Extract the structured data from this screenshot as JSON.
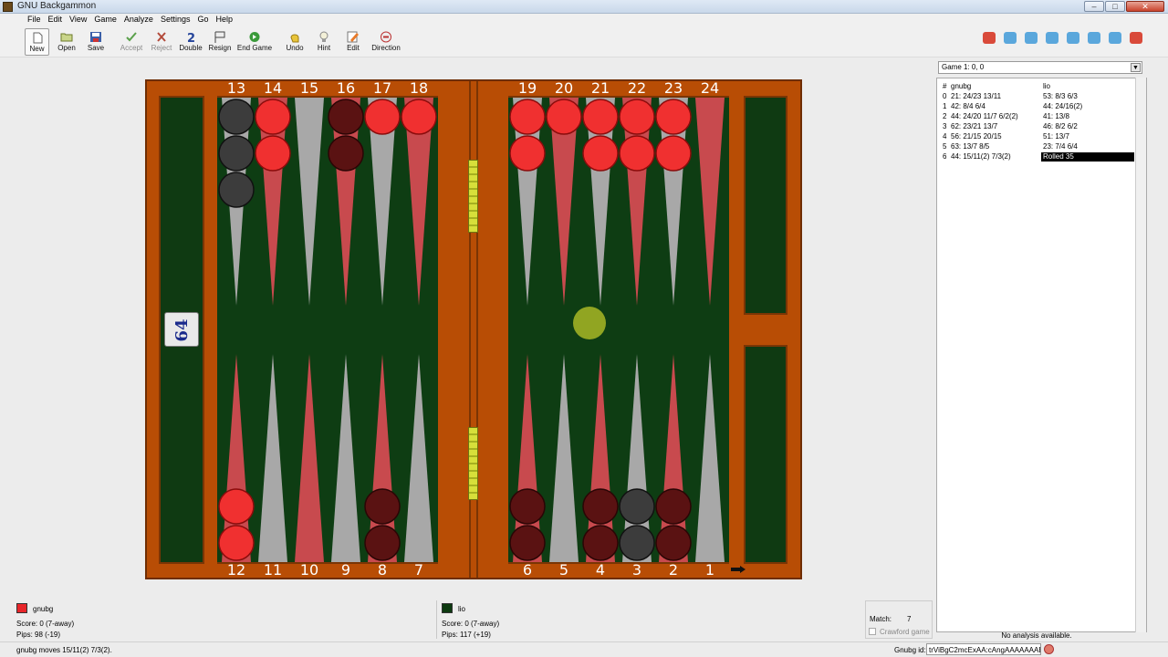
{
  "window": {
    "title": "GNU Backgammon",
    "minimize": "–",
    "maximize": "□",
    "close": "✕"
  },
  "menu": [
    "File",
    "Edit",
    "View",
    "Game",
    "Analyze",
    "Settings",
    "Go",
    "Help"
  ],
  "toolbar": [
    {
      "label": "New",
      "icon": "new-document-icon",
      "state": "pressed"
    },
    {
      "label": "Open",
      "icon": "open-folder-icon",
      "state": "normal"
    },
    {
      "label": "Save",
      "icon": "save-disk-icon",
      "state": "normal"
    },
    {
      "label": "Accept",
      "icon": "check-icon",
      "state": "disabled"
    },
    {
      "label": "Reject",
      "icon": "cross-icon",
      "state": "disabled"
    },
    {
      "label": "Double",
      "icon": "double-2-icon",
      "state": "normal"
    },
    {
      "label": "Resign",
      "icon": "flag-icon",
      "state": "normal"
    },
    {
      "label": "End Game",
      "icon": "end-game-icon",
      "state": "normal"
    },
    {
      "label": "Undo",
      "icon": "undo-hand-icon",
      "state": "normal"
    },
    {
      "label": "Hint",
      "icon": "lightbulb-icon",
      "state": "normal"
    },
    {
      "label": "Edit",
      "icon": "pencil-icon",
      "state": "normal"
    },
    {
      "label": "Direction",
      "icon": "direction-icon",
      "state": "normal"
    }
  ],
  "nav_icons": [
    "prev-game-icon",
    "prev-roll-icon",
    "prev-marked-icon",
    "prev-cmark-icon",
    "next-cmark-icon",
    "next-marked-icon",
    "next-roll-icon",
    "next-game-icon",
    "stop-icon"
  ],
  "colors": {
    "player1": "#e8262a",
    "player2": "#3a3a3a",
    "board_frame": "#b84d05",
    "felt": "#0e3d13",
    "point_red": "#c84a4e",
    "point_grey": "#a8a8a8"
  },
  "board": {
    "top_numbers": [
      "13",
      "14",
      "15",
      "16",
      "17",
      "18",
      "19",
      "20",
      "21",
      "22",
      "23",
      "24"
    ],
    "bottom_numbers": [
      "12",
      "11",
      "10",
      "9",
      "8",
      "7",
      "6",
      "5",
      "4",
      "3",
      "2",
      "1"
    ],
    "cube": "64",
    "checkers": {
      "top": [
        {
          "point": "13",
          "color": "dark",
          "count": 3
        },
        {
          "point": "14",
          "color": "red",
          "count": 2
        },
        {
          "point": "15",
          "color": "",
          "count": 0
        },
        {
          "point": "16",
          "color": "maroon",
          "count": 2
        },
        {
          "point": "17",
          "color": "red",
          "count": 1
        },
        {
          "point": "18",
          "color": "red",
          "count": 1
        },
        {
          "point": "19",
          "color": "red",
          "count": 2
        },
        {
          "point": "20",
          "color": "red",
          "count": 1
        },
        {
          "point": "21",
          "color": "red",
          "count": 2
        },
        {
          "point": "22",
          "color": "red",
          "count": 2
        },
        {
          "point": "23",
          "color": "red",
          "count": 2
        },
        {
          "point": "24",
          "color": "",
          "count": 0
        }
      ],
      "bottom": [
        {
          "point": "12",
          "color": "red",
          "count": 2
        },
        {
          "point": "11",
          "color": "",
          "count": 0
        },
        {
          "point": "10",
          "color": "",
          "count": 0
        },
        {
          "point": "9",
          "color": "",
          "count": 0
        },
        {
          "point": "8",
          "color": "maroon",
          "count": 2
        },
        {
          "point": "7",
          "color": "",
          "count": 0
        },
        {
          "point": "6",
          "color": "maroon",
          "count": 2
        },
        {
          "point": "5",
          "color": "",
          "count": 0
        },
        {
          "point": "4",
          "color": "maroon",
          "count": 2
        },
        {
          "point": "3",
          "color": "dark",
          "count": 2
        },
        {
          "point": "2",
          "color": "maroon",
          "count": 2
        },
        {
          "point": "1",
          "color": "",
          "count": 0
        }
      ]
    }
  },
  "game_select": "Game 1: 0, 0",
  "movelist": {
    "headers": [
      "#",
      "gnubg",
      "lio"
    ],
    "rows": [
      {
        "n": "0",
        "gnubg": "21: 24/23 13/11",
        "lio": "53: 8/3 6/3",
        "selected": false
      },
      {
        "n": "1",
        "gnubg": "42: 8/4 6/4",
        "lio": "44: 24/16(2)",
        "selected": false
      },
      {
        "n": "2",
        "gnubg": "44: 24/20 11/7 6/2(2)",
        "lio": "41: 13/8",
        "selected": false
      },
      {
        "n": "3",
        "gnubg": "62: 23/21 13/7",
        "lio": "46: 8/2 6/2",
        "selected": false
      },
      {
        "n": "4",
        "gnubg": "56: 21/15 20/15",
        "lio": "51: 13/7",
        "selected": false
      },
      {
        "n": "5",
        "gnubg": "63: 13/7 8/5",
        "lio": "23: 7/4 6/4",
        "selected": false
      },
      {
        "n": "6",
        "gnubg": "44: 15/11(2) 7/3(2)",
        "lio": "Rolled 35",
        "selected": true
      }
    ]
  },
  "no_analysis": "No analysis available.",
  "players": [
    {
      "name": "gnubg",
      "score": "Score:  0 (7-away)",
      "pips": "Pips: 98 (-19)",
      "color": "#e8262a"
    },
    {
      "name": "lio",
      "score": "Score:  0 (7-away)",
      "pips": "Pips: 117 (+19)",
      "color": "#0d3a10"
    }
  ],
  "match": {
    "label": "Match:",
    "value": "7",
    "crawford": "Crawford game"
  },
  "status": {
    "message": "gnubg moves 15/11(2) 7/3(2).",
    "id_label": "Gnubg id:",
    "id_value": "trViBgC2mcExAA:cAngAAAAAAAE"
  }
}
